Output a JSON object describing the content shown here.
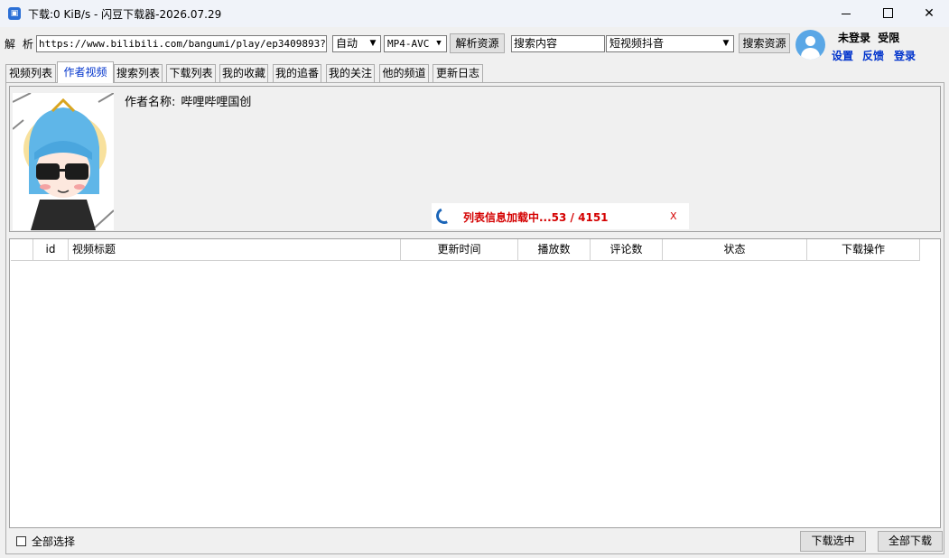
{
  "window": {
    "title": "下载:0 KiB/s - 闪豆下载器-2026.07.29"
  },
  "toolbar": {
    "parse_label": "解 析:",
    "url_value": "https://www.bilibili.com/bangumi/play/ep3409893?",
    "quality_value": "自动",
    "codec_value": "MP4-AVC",
    "parse_button": "解析资源",
    "search_placeholder": "搜索内容",
    "search_type_value": "短视频抖音",
    "search_button": "搜索资源"
  },
  "user": {
    "status_login": "未登录",
    "status_limit": "受限",
    "links": [
      "设置",
      "反馈",
      "登录"
    ]
  },
  "tabs": [
    {
      "label": "视频列表"
    },
    {
      "label": "作者视频",
      "active": true
    },
    {
      "label": "搜索列表"
    },
    {
      "label": "下载列表"
    },
    {
      "label": "我的收藏"
    },
    {
      "label": "我的追番"
    },
    {
      "label": "我的关注"
    },
    {
      "label": "他的频道"
    },
    {
      "label": "更新日志"
    }
  ],
  "author": {
    "name_label": "作者名称:",
    "name": "哔哩哔哩国创"
  },
  "loading": {
    "text": "列表信息加载中...53 / 4151",
    "close": "X"
  },
  "table": {
    "columns": [
      "",
      "id",
      "视频标题",
      "更新时间",
      "播放数",
      "评论数",
      "状态",
      "下载操作"
    ],
    "rows": []
  },
  "footer": {
    "select_all": "全部选择",
    "download_selected": "下载选中",
    "download_all": "全部下载"
  },
  "colors": {
    "accent": "#0033cc",
    "loading_text": "#d40000",
    "avatar_bg": "#5aa7e6"
  }
}
